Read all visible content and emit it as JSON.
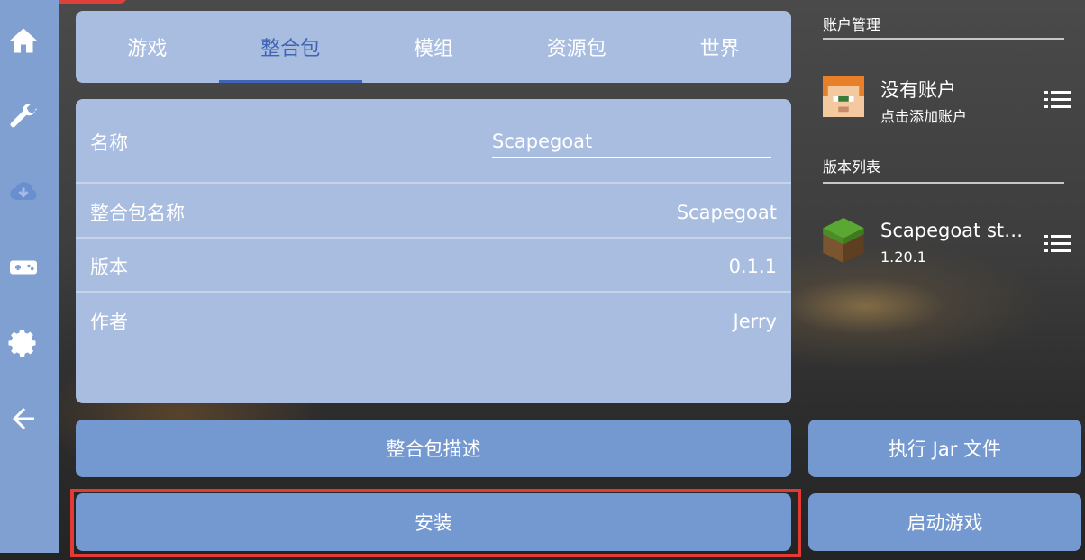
{
  "tabs": [
    "游戏",
    "整合包",
    "模组",
    "资源包",
    "世界"
  ],
  "active_tab": 1,
  "fields": {
    "name_label": "名称",
    "name_value": "Scapegoat",
    "pack_name_label": "整合包名称",
    "pack_name_value": "Scapegoat",
    "version_label": "版本",
    "version_value": "0.1.1",
    "author_label": "作者",
    "author_value": "Jerry"
  },
  "buttons": {
    "description": "整合包描述",
    "install": "安装",
    "run_jar": "执行 Jar 文件",
    "launch": "启动游戏"
  },
  "account": {
    "section_title": "账户管理",
    "title": "没有账户",
    "subtitle": "点击添加账户"
  },
  "versions": {
    "section_title": "版本列表",
    "items": [
      {
        "title": "Scapegoat st…",
        "subtitle": "1.20.1"
      }
    ]
  },
  "sidebar_icons": [
    "home-icon",
    "wrench-icon",
    "cloud-download-icon",
    "gamepad-icon",
    "gear-icon",
    "back-arrow-icon"
  ],
  "colors": {
    "sidebar": "#7fa0d0",
    "panel": "#a9bde0",
    "button": "#7498d0",
    "active_tab": "#3f63b5",
    "highlight": "#e53935"
  }
}
